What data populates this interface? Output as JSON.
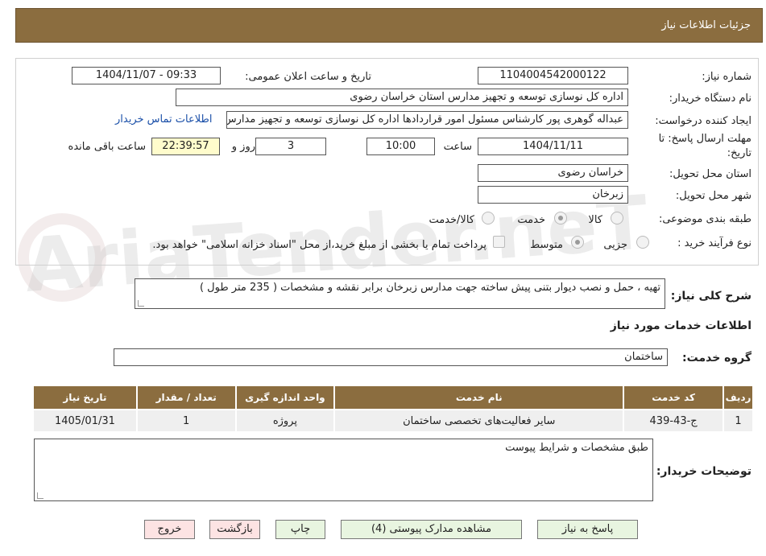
{
  "header": {
    "title": "جزئیات اطلاعات نیاز"
  },
  "watermark": {
    "text": "AriaTender.neT"
  },
  "fields": {
    "need_number_label": "شماره نیاز:",
    "need_number": "1104004542000122",
    "announce_label": "تاریخ و ساعت اعلان عمومی:",
    "announce_value": "1404/11/07 - 09:33",
    "buyer_org_label": "نام دستگاه خریدار:",
    "buyer_org": "اداره کل نوسازی  توسعه و تجهیز مدارس استان خراسان رضوی",
    "creator_label": "ایجاد کننده درخواست:",
    "creator": "عبداله گوهری پور کارشناس مسئول امور قراردادها  اداره کل نوسازی  توسعه و تجهیز مدارس استان خراسان رضوی",
    "contact_link": "اطلاعات تماس خریدار",
    "deadline_label_1": "مهلت ارسال پاسخ: تا",
    "deadline_label_2": "تاریخ:",
    "deadline_date": "1404/11/11",
    "time_label": "ساعت",
    "deadline_time": "10:00",
    "days_value": "3",
    "days_label": "روز و",
    "remaining_time": "22:39:57",
    "remaining_label": "ساعت باقی مانده",
    "province_label": "استان محل تحویل:",
    "province": "خراسان رضوی",
    "city_label": "شهر محل تحویل:",
    "city": "زبرخان",
    "category_label": "طبقه بندی موضوعی:",
    "category_options": [
      "کالا",
      "خدمت",
      "کالا/خدمت"
    ],
    "category_selected": "خدمت",
    "process_label": "نوع فرآیند خرید :",
    "process_options": [
      "جزیی",
      "متوسط"
    ],
    "process_selected": "متوسط",
    "payment_note": "پرداخت تمام یا بخشی از مبلغ خرید،از محل \"اسناد خزانه اسلامی\" خواهد بود."
  },
  "description": {
    "label": "شرح کلی نیاز:",
    "value": "تهیه ، حمل و نصب دیوار بتنی پیش ساخته جهت مدارس زبرخان برابر نقشه و مشخصات ( 235 متر طول )"
  },
  "services_section": {
    "title": "اطلاعات خدمات مورد نیاز",
    "group_label": "گروه خدمت:",
    "group_value": "ساختمان"
  },
  "table": {
    "headers": [
      "ردیف",
      "کد خدمت",
      "نام خدمت",
      "واحد اندازه گیری",
      "تعداد / مقدار",
      "تاریخ نیاز"
    ],
    "rows": [
      [
        "1",
        "ج-43-439",
        "سایر فعالیت‌های تخصصی ساختمان",
        "پروژه",
        "1",
        "1405/01/31"
      ]
    ]
  },
  "buyer_notes": {
    "label": "توضیحات خریدار:",
    "value": "طبق مشخصات و شرایط پیوست"
  },
  "buttons": {
    "reply": "پاسخ به نیاز",
    "attachments": "مشاهده مدارک پیوستی (4)",
    "print": "چاپ",
    "back": "بازگشت",
    "exit": "خروج"
  }
}
